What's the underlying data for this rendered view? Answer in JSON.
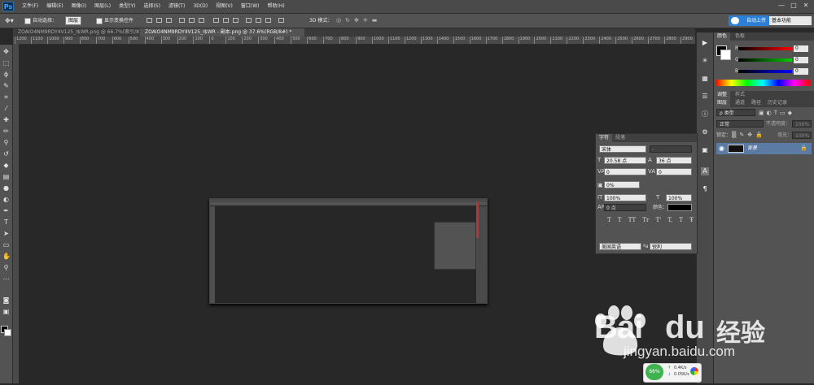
{
  "app": {
    "logo": "Ps"
  },
  "menu": {
    "items": [
      "文件(F)",
      "编辑(E)",
      "图像(I)",
      "图层(L)",
      "类型(Y)",
      "选择(S)",
      "滤镜(T)",
      "3D(D)",
      "视图(V)",
      "窗口(W)",
      "帮助(H)"
    ]
  },
  "window_controls": {
    "minimize": "—",
    "maximize": "□",
    "close": "✕"
  },
  "options_bar": {
    "auto_select_label": "自动选择：",
    "auto_select_value": "图层",
    "show_transform_label": "显示变换控件",
    "mode_3d_label": "3D 模式："
  },
  "topright": {
    "upload_label": "自动上传",
    "workspace": "基本功能"
  },
  "tabs": [
    {
      "label": "ZOAIO4NM9RDY4V125_I$WR.png @ 66.7%(索引/8) *"
    },
    {
      "label": "ZOAIO4NM9RDY4V125_I$WR - 副本.png @ 37.6%(RGB/8#) *"
    }
  ],
  "ruler": {
    "ticks": [
      "1200",
      "1100",
      "1000",
      "900",
      "800",
      "700",
      "600",
      "500",
      "400",
      "300",
      "200",
      "100",
      "0",
      "100",
      "200",
      "300",
      "400",
      "500",
      "600",
      "700",
      "800",
      "900",
      "1000",
      "1100",
      "1200",
      "1300",
      "1400",
      "1500",
      "1600",
      "1700",
      "1800",
      "1900",
      "2000",
      "2100",
      "2200",
      "2300",
      "2400",
      "2500",
      "2600",
      "2700",
      "2800",
      "2900"
    ]
  },
  "color_panel": {
    "tabs": [
      "颜色",
      "色板"
    ],
    "channels": [
      {
        "label": "R",
        "value": "0",
        "color": "#e03030"
      },
      {
        "label": "G",
        "value": "0",
        "color": "#30b030"
      },
      {
        "label": "B",
        "value": "0",
        "color": "#3050e0"
      }
    ]
  },
  "adjust_panel": {
    "tabs": [
      "调整",
      "样式"
    ]
  },
  "layers_panel": {
    "tabs": [
      "图层",
      "通道",
      "路径",
      "历史记录"
    ],
    "kind_label": "ρ 类型",
    "blend_mode": "正常",
    "opacity_label": "不透明度：",
    "opacity_value": "100%",
    "lock_label": "锁定：",
    "fill_label": "填充：",
    "fill_value": "100%",
    "layer_name": "背景"
  },
  "character_panel": {
    "tabs": [
      "字符",
      "段落"
    ],
    "font_family": "宋体",
    "font_style": "-",
    "font_size": "20.58 点",
    "leading": "36 点",
    "kerning": "0",
    "tracking": "0",
    "scale_pct": "0%",
    "vscale": "100%",
    "hscale": "100%",
    "baseline": "0 点",
    "color_label": "颜色：",
    "styles": [
      "T",
      "T",
      "TT",
      "Tr",
      "T'",
      "T,",
      "T",
      "Ŧ"
    ],
    "language": "美国英语",
    "aa_label": "ªa",
    "aa_value": "锐利"
  },
  "watermark": {
    "brand": "Bai",
    "brand2": "du",
    "jingyan": "经验",
    "url": "jingyan.baidu.com"
  },
  "net_widget": {
    "percent": "66%",
    "up": "0.4K/s",
    "down": "0.05K/s"
  }
}
